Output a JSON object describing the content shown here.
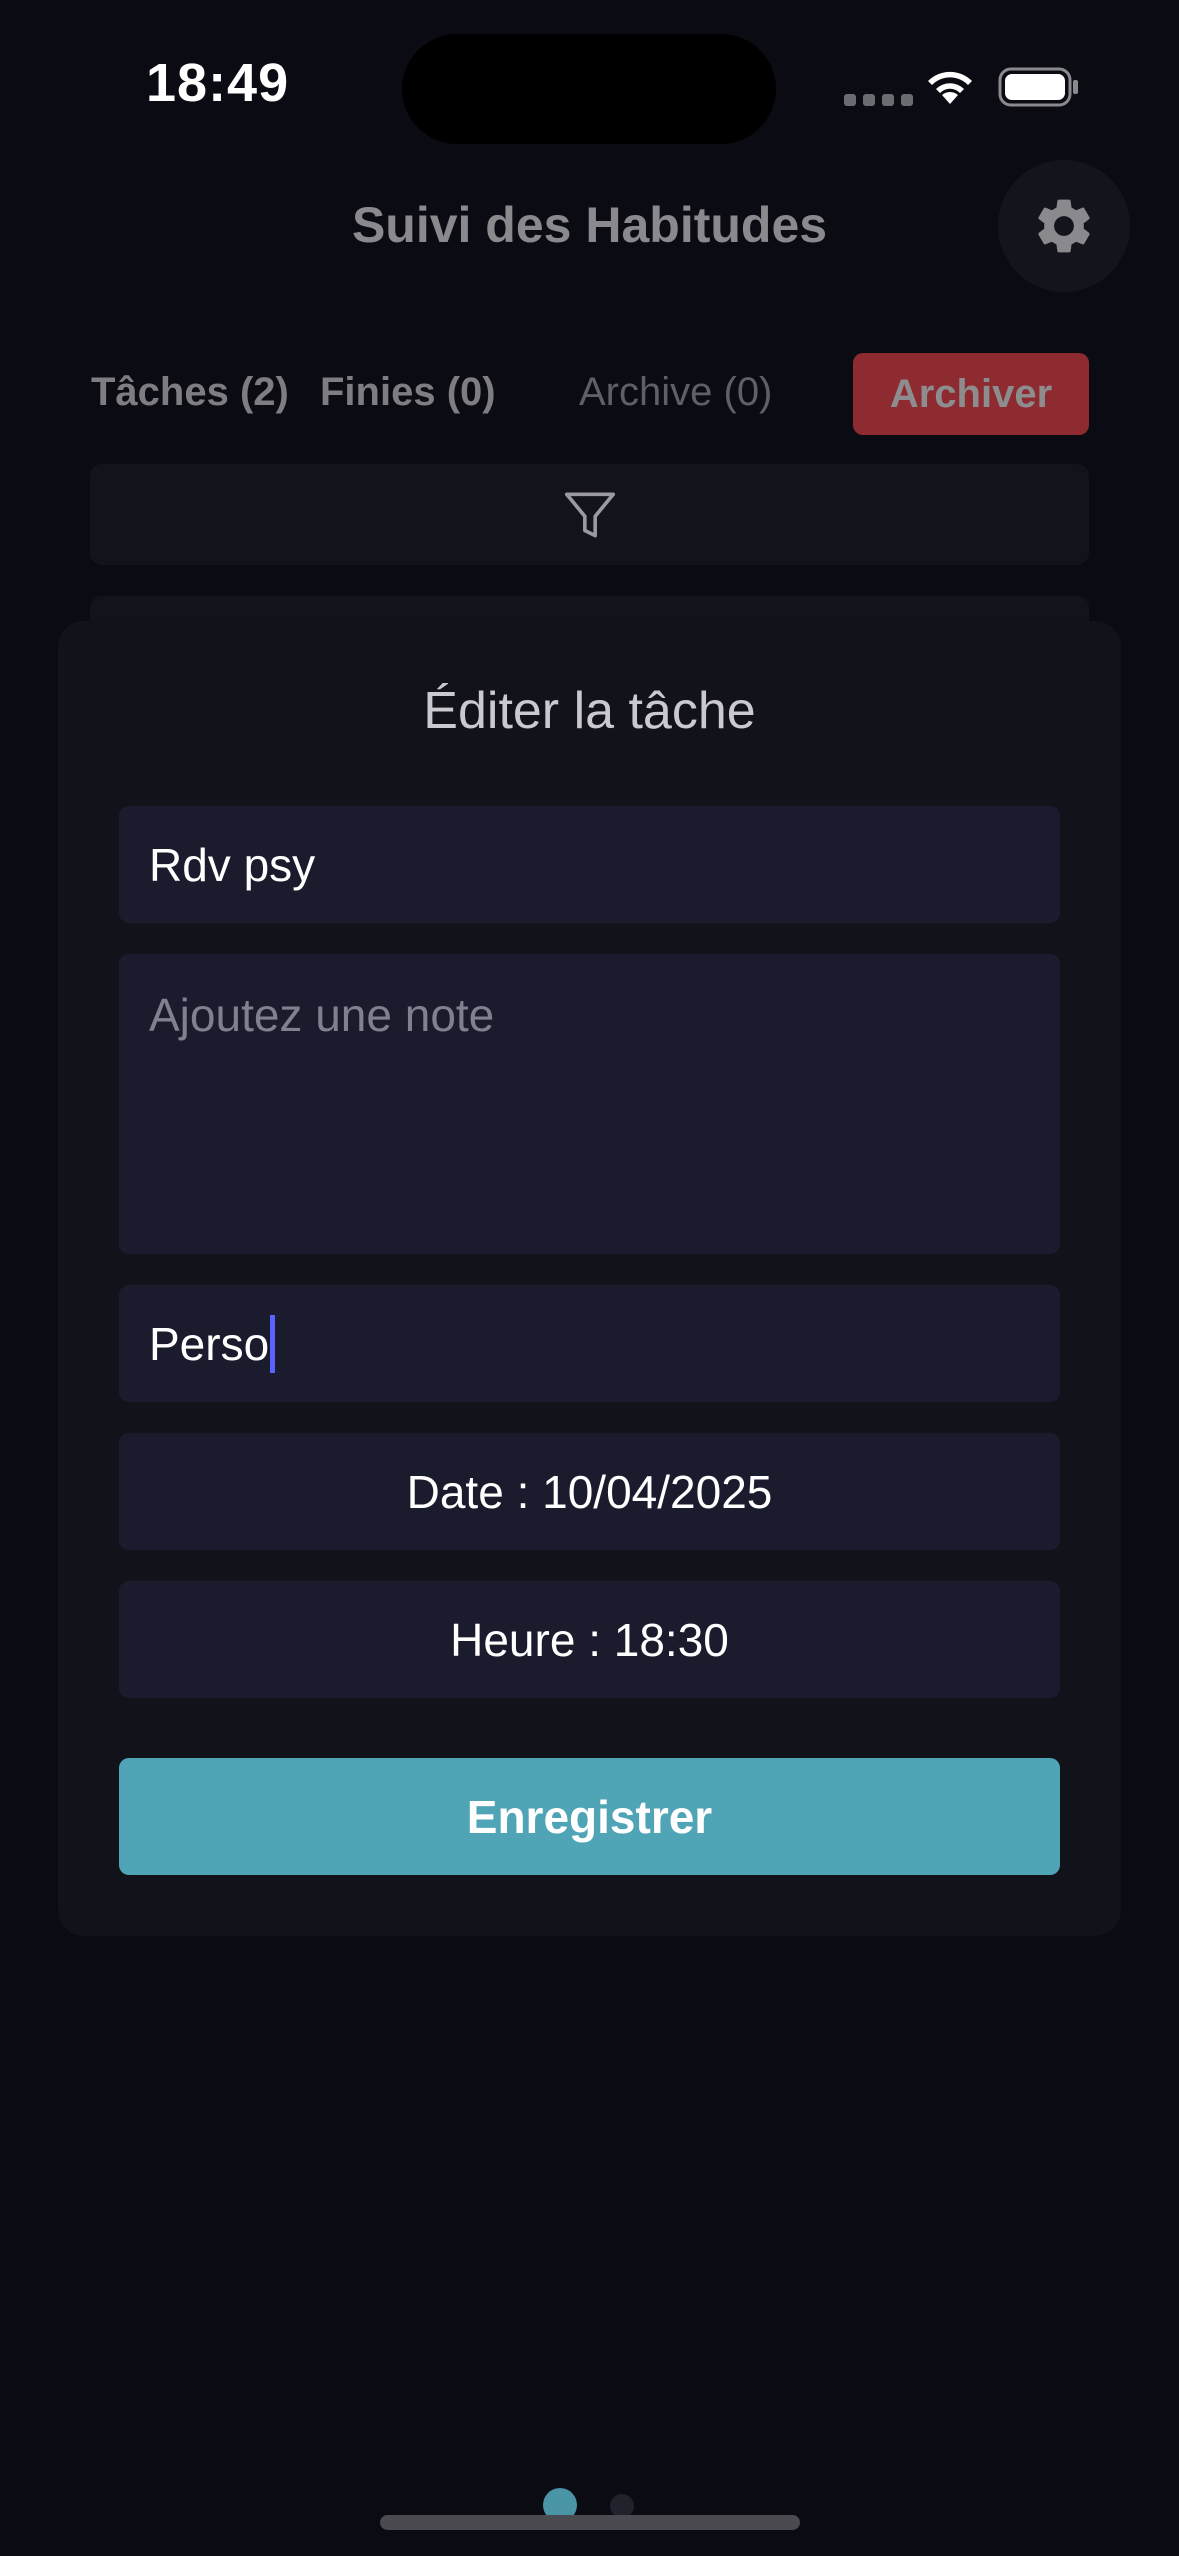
{
  "status_bar": {
    "time": "18:49"
  },
  "header": {
    "title": "Suivi des Habitudes",
    "settings_icon": "gear-icon"
  },
  "tabs": {
    "tasks": "Tâches (2)",
    "finished": "Finies (0)",
    "archive": "Archive (0)",
    "archive_action": "Archiver"
  },
  "filter": {
    "icon": "filter-icon"
  },
  "modal": {
    "title": "Éditer la tâche",
    "name_value": "Rdv psy",
    "note_placeholder": "Ajoutez une note",
    "category_value": "Perso",
    "date_label": "Date : 10/04/2025",
    "time_label": "Heure : 18:30",
    "save_label": "Enregistrer"
  },
  "colors": {
    "background": "#0b0b13",
    "modal": "#12121b",
    "field": "#1b1b2e",
    "accent": "#4fa4b6",
    "archive_button": "#8e2b30",
    "caret": "#5a63ff"
  },
  "pager": {
    "pages": 2,
    "active": 1
  }
}
